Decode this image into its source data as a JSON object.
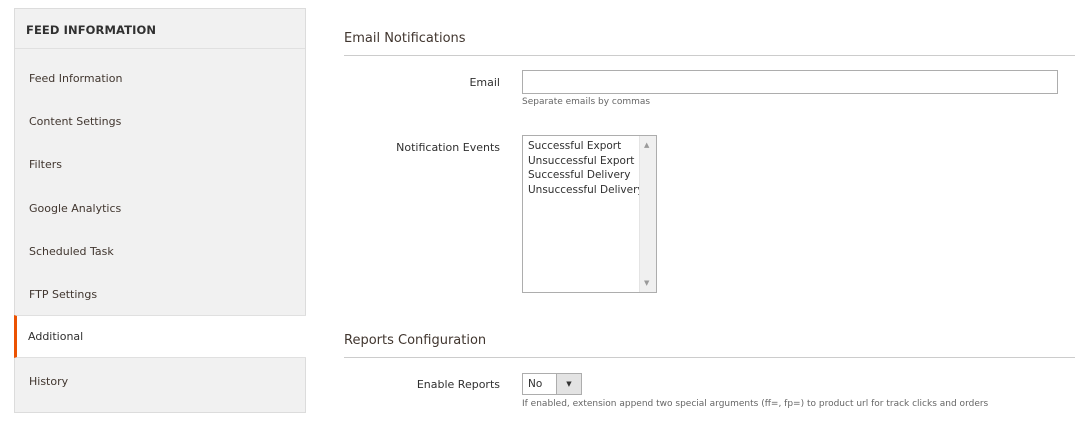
{
  "sidebar": {
    "title": "FEED INFORMATION",
    "items": [
      {
        "label": "Feed Information"
      },
      {
        "label": "Content Settings"
      },
      {
        "label": "Filters"
      },
      {
        "label": "Google Analytics"
      },
      {
        "label": "Scheduled Task"
      },
      {
        "label": "FTP Settings"
      },
      {
        "label": "Additional",
        "active": true
      },
      {
        "label": "History"
      }
    ]
  },
  "email_notifications": {
    "title": "Email Notifications",
    "email": {
      "label": "Email",
      "value": "",
      "note": "Separate emails by commas"
    },
    "events": {
      "label": "Notification Events",
      "options": [
        "Successful Export",
        "Unsuccessful Export",
        "Successful Delivery",
        "Unsuccessful Delivery"
      ],
      "scroll_up_icon": "triangle-up-icon",
      "scroll_down_icon": "triangle-down-icon"
    }
  },
  "reports": {
    "title": "Reports Configuration",
    "enable": {
      "label": "Enable Reports",
      "value": "No",
      "note": "If enabled, extension append two special arguments (ff=, fp=) to product url for track clicks and orders",
      "icon": "chevron-down-icon"
    }
  },
  "colors": {
    "accent": "#eb5202",
    "sidebar_bg": "#f1f1f1"
  }
}
